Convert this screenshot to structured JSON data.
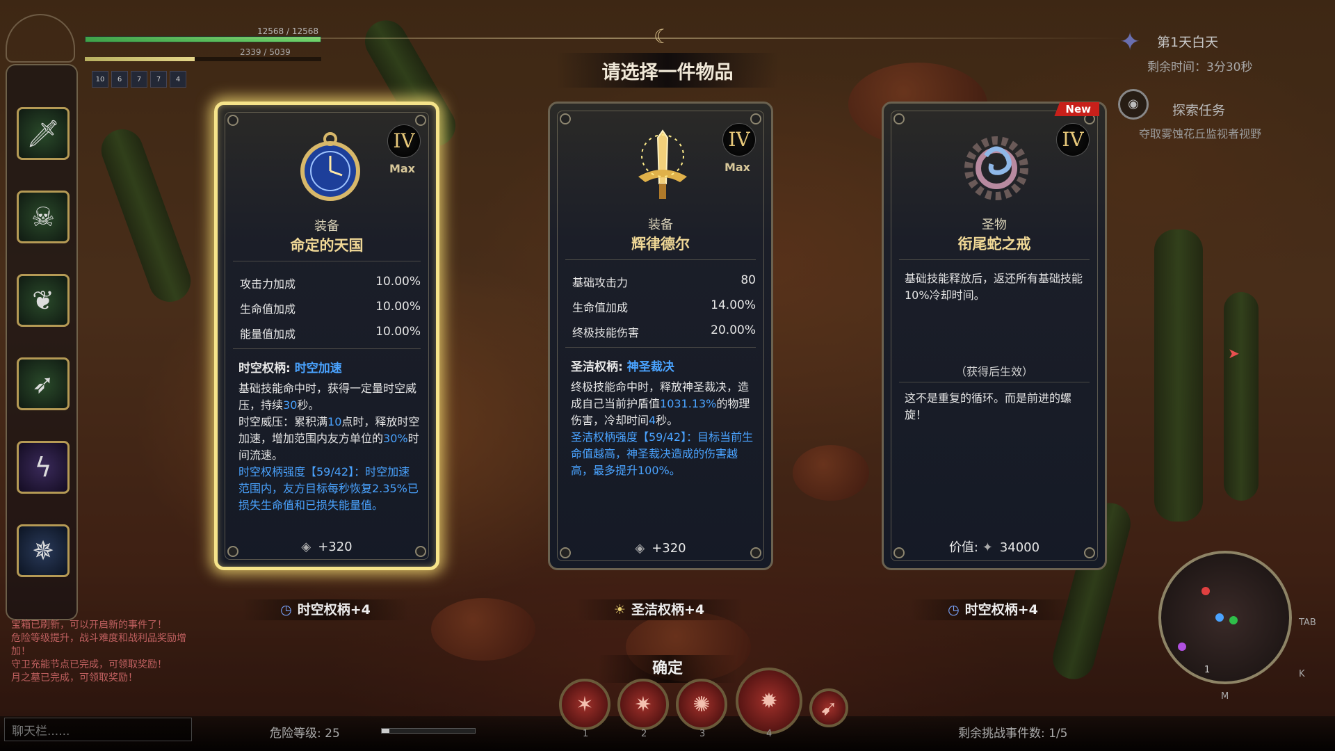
{
  "hud": {
    "hp_text": "12568 / 12568",
    "hp_fraction": 1.0,
    "mp_text": "2339 / 5039",
    "mp_fraction": 0.464,
    "buffs": [
      "10",
      "6",
      "7",
      "7",
      "4"
    ]
  },
  "day": {
    "title": "第1天白天",
    "time": "剩余时间：3分30秒"
  },
  "quest": {
    "title": "探索任务",
    "desc": "夺取雾蚀花丘监视者视野"
  },
  "title": "请选择一件物品",
  "cards": [
    {
      "roman": "IV",
      "max_label": "Max",
      "category": "装备",
      "name": "命定的天国",
      "stats": [
        {
          "label": "攻击力加成",
          "value": "10.00%"
        },
        {
          "label": "生命值加成",
          "value": "10.00%"
        },
        {
          "label": "能量值加成",
          "value": "10.00%"
        }
      ],
      "skill_prefix": "时空权柄: ",
      "skill_name": "时空加速",
      "desc_1": "基础技能命中时，获得一定量时空威压，持续",
      "desc_1b": "30",
      "desc_1c": "秒。",
      "desc_2": "时空威压：累积满",
      "desc_2b": "10",
      "desc_2c": "点时，释放时空加速，增加范围内友方单位的",
      "desc_2d": "30%",
      "desc_2e": "时间流速。",
      "desc_3": "时空权柄强度【59/42】：时空加速范围内，友方目标每秒恢复2.35%已损失生命值和已损失能量值。",
      "price": "+320",
      "below": "时空权柄+4"
    },
    {
      "roman": "IV",
      "max_label": "Max",
      "category": "装备",
      "name": "辉律德尔",
      "stats": [
        {
          "label": "基础攻击力",
          "value": "80"
        },
        {
          "label": "生命值加成",
          "value": "14.00%"
        },
        {
          "label": "终极技能伤害",
          "value": "20.00%"
        }
      ],
      "skill_prefix": "圣洁权柄: ",
      "skill_name": "神圣裁决",
      "desc_1": "终极技能命中时，释放神圣裁决，造成自己当前护盾值",
      "desc_1b": "1031.13%",
      "desc_1c": "的物理伤害，冷却时间",
      "desc_1d": "4",
      "desc_1e": "秒。",
      "desc_3": "圣洁权柄强度【59/42】：目标当前生命值越高，神圣裁决造成的伤害越高，最多提升100%。",
      "price": "+320",
      "below": "圣洁权柄+4"
    },
    {
      "roman": "IV",
      "new_tag": "New",
      "category": "圣物",
      "name": "衔尾蛇之戒",
      "effect": "基础技能释放后，返还所有基础技能10%冷却时间。",
      "pending": "（获得后生效）",
      "flavor": "这不是重复的循环。而是前进的螺旋！",
      "price_label": "价值:",
      "price": "34000",
      "below": "时空权柄+4"
    }
  ],
  "confirm": "确定",
  "log": [
    "宝箱已刷新，可以开启新的事件了！",
    "危险等级提升，战斗难度和战利品奖励增加！",
    "守卫充能节点已完成，可领取奖励！",
    "月之墓已完成，可领取奖励！"
  ],
  "chat_placeholder": "聊天栏......",
  "danger": "危险等级: 25",
  "danger_fraction": 0.08,
  "events": "剩余挑战事件数: 1/5",
  "ability_keys": [
    "1",
    "2",
    "3",
    "4"
  ],
  "minimap": {
    "tab": "TAB",
    "k": "K",
    "m": "M",
    "one": "1"
  },
  "colors": {
    "highlight": "#4aa3ff",
    "gold": "#f0d896",
    "selected_glow": "#f6e48a",
    "new_tag": "#c8201a"
  },
  "icons": [
    "pocket-watch-icon",
    "winged-sword-icon",
    "ouroboros-ring-icon"
  ]
}
